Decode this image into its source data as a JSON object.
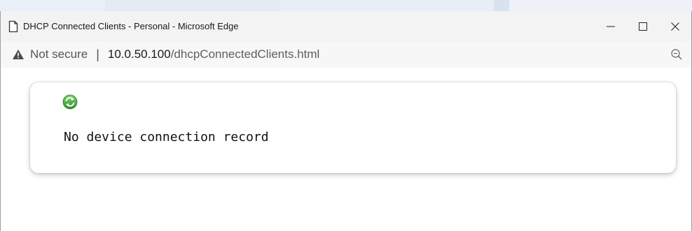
{
  "window": {
    "title": "DHCP Connected Clients - Personal - Microsoft Edge",
    "controls": {
      "minimize_icon": "minimize-icon",
      "maximize_icon": "maximize-icon",
      "close_icon": "close-icon"
    }
  },
  "address_bar": {
    "security_icon": "warning-icon",
    "security_label": "Not secure",
    "separator": "|",
    "url_host": "10.0.50.100",
    "url_path": "/dhcpConnectedClients.html",
    "zoom_icon": "zoom-out-icon"
  },
  "page": {
    "refresh_icon": "refresh-icon",
    "empty_message": "No device connection record"
  },
  "colors": {
    "titlebar_bg": "#f3f3f3",
    "refresh_green": "#3aa53a",
    "text": "#111111"
  }
}
